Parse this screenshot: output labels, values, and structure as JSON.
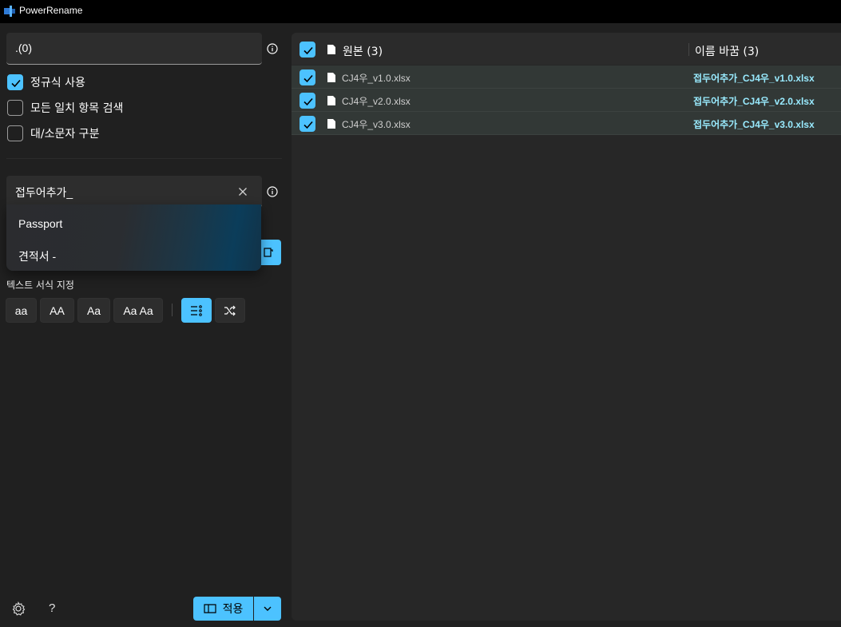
{
  "window": {
    "title": "PowerRename"
  },
  "search": {
    "value": ".(0)"
  },
  "options": [
    {
      "label": "정규식 사용",
      "checked": true
    },
    {
      "label": "모든 일치 항목 검색",
      "checked": false
    },
    {
      "label": "대/소문자 구분",
      "checked": false
    }
  ],
  "replace": {
    "value": "접두어추가_"
  },
  "suggestions": [
    "Passport",
    "견적서 -"
  ],
  "formatting": {
    "label": "텍스트 서식 지정",
    "buttons": [
      "aa",
      "AA",
      "Aa",
      "Aa Aa"
    ]
  },
  "footer": {
    "help": "?",
    "apply_label": "적용"
  },
  "table": {
    "original_header": "원본 (3)",
    "renamed_header": "이름 바꿈 (3)",
    "rows": [
      {
        "original": "CJ4우_v1.0.xlsx",
        "renamed": "접두어추가_CJ4우_v1.0.xlsx",
        "checked": true
      },
      {
        "original": "CJ4우_v2.0.xlsx",
        "renamed": "접두어추가_CJ4우_v2.0.xlsx",
        "checked": true
      },
      {
        "original": "CJ4우_v3.0.xlsx",
        "renamed": "접두어추가_CJ4우_v3.0.xlsx",
        "checked": true
      }
    ]
  },
  "colors": {
    "accent": "#4cc2ff",
    "new_name": "#99ebff"
  }
}
